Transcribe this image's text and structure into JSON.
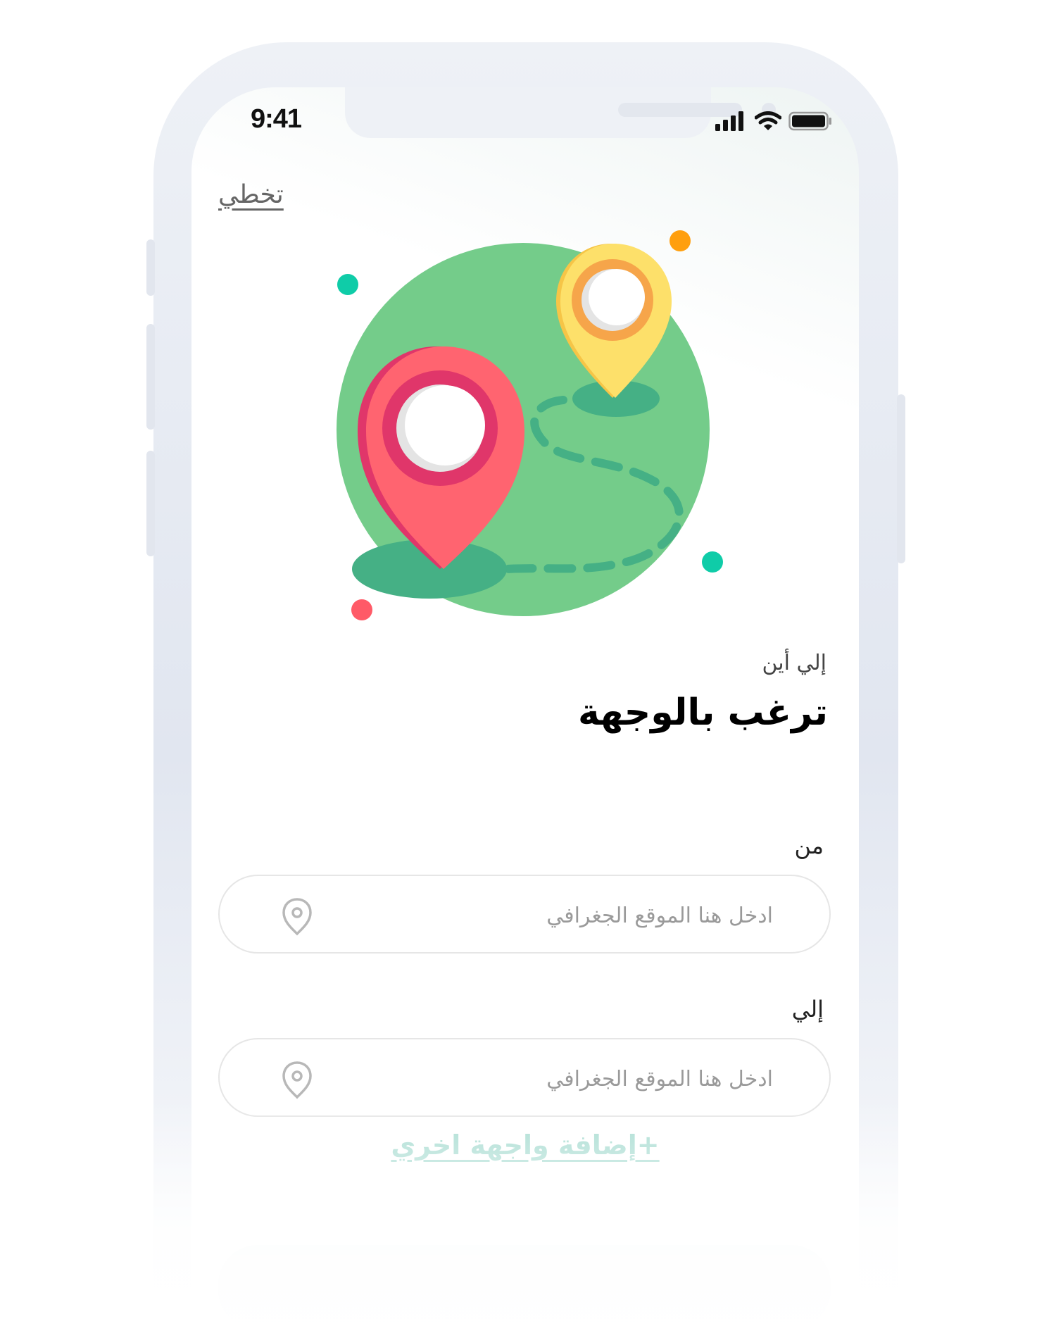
{
  "status_bar": {
    "time": "9:41"
  },
  "header": {
    "skip_label": "تخطي"
  },
  "prompt": {
    "question": "إلي أين",
    "headline": "ترغب بالوجهة"
  },
  "from_field": {
    "label": "من",
    "placeholder": "ادخل هنا الموقع الجغرافي",
    "icon": "location-pin-icon"
  },
  "to_field": {
    "label": "إلي",
    "placeholder": "ادخل هنا الموقع الجغرافي",
    "icon": "location-pin-icon"
  },
  "actions": {
    "add_destination": "+إضافة واجهة اخري"
  },
  "colors": {
    "globe": "#74cc8a",
    "globe_shadow": "#45b085",
    "pin_red": "#ff6470",
    "pin_red_ring": "#e0366a",
    "pin_yellow": "#fde06a",
    "pin_yellow_ring": "#f6a54a",
    "accent_teal": "#0fcca8",
    "accent_orange": "#ff9f0e",
    "link": "#a6dbd0"
  }
}
